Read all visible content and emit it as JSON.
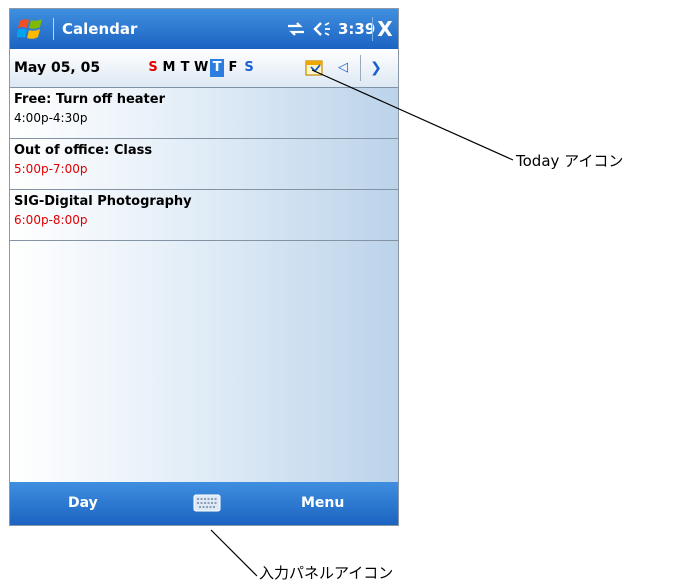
{
  "titlebar": {
    "app_title": "Calendar",
    "clock": "3:39",
    "close_label": "X"
  },
  "datebar": {
    "date": "May 05, 05",
    "weekdays": [
      "S",
      "M",
      "T",
      "W",
      "T",
      "F",
      "S"
    ],
    "selected_day_index": 4
  },
  "appointments": [
    {
      "title": "Free: Turn off heater",
      "time": "4:00p-4:30p",
      "busy": false
    },
    {
      "title": "Out of office: Class",
      "time": "5:00p-7:00p",
      "busy": true
    },
    {
      "title": "SIG-Digital Photography",
      "time": "6:00p-8:00p",
      "busy": true
    }
  ],
  "menubar": {
    "left_softkey": "Day",
    "right_softkey": "Menu"
  },
  "callouts": {
    "today_icon": "Today アイコン",
    "input_panel_icon": "入力パネルアイコン"
  },
  "icons": {
    "start": "windows-flag-icon",
    "connectivity": "connectivity-icon",
    "volume": "volume-icon",
    "today": "today-icon",
    "input_panel": "keyboard-icon"
  },
  "colors": {
    "titlebar": "#2b7de0",
    "busy_text": "#e00000",
    "selected_day": "#2b7de0"
  }
}
